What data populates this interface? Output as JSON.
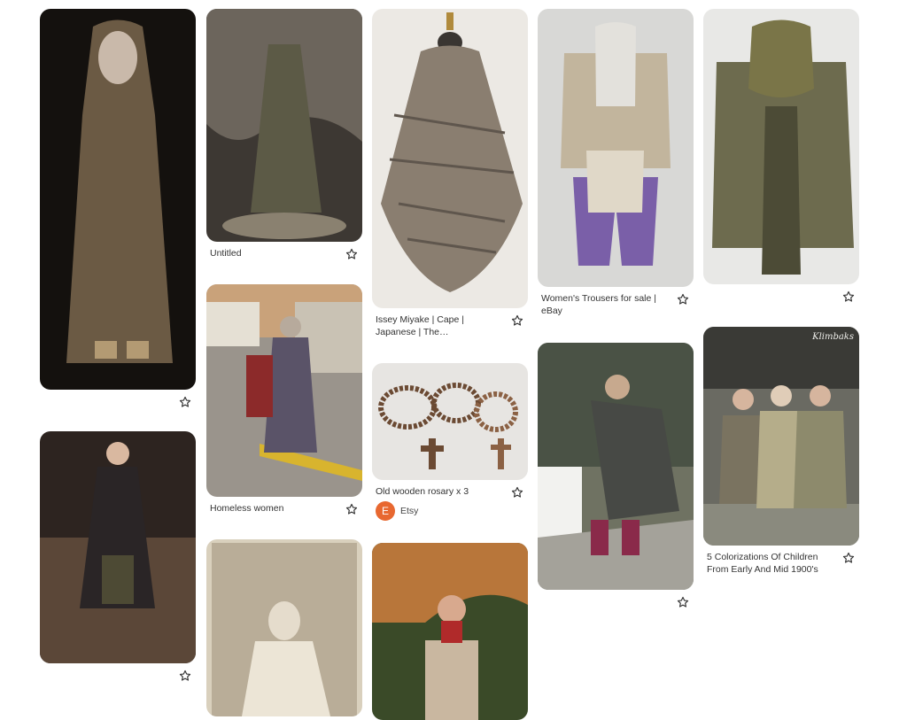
{
  "colors": {
    "text": "#333333",
    "etsy": "#e86830"
  },
  "save_icon_name": "star-outline-icon",
  "pins": [
    {
      "id": "p1",
      "title": "",
      "image_desc": "Hooded figure in layered tattered brown robes",
      "colors": [
        "#14110e",
        "#6b5a44",
        "#3a2f24"
      ]
    },
    {
      "id": "p2",
      "title": "",
      "image_desc": "Woman in dark plaid coat on runway",
      "colors": [
        "#2d2420",
        "#5a3a35",
        "#8b6b55"
      ]
    },
    {
      "id": "p3",
      "title": "Untitled",
      "image_desc": "Mannequin in ragged green costume with cloak",
      "colors": [
        "#3d3833",
        "#5c5a46",
        "#8a8170"
      ]
    },
    {
      "id": "p4",
      "title": "Homeless women",
      "image_desc": "Older woman carrying bags on street",
      "colors": [
        "#9a948c",
        "#5a5368",
        "#c9c2b4"
      ]
    },
    {
      "id": "p5",
      "title": "",
      "image_desc": "Sepia photo of child in white clothing",
      "colors": [
        "#b9ad98",
        "#8a7d69",
        "#d9d0bd"
      ]
    },
    {
      "id": "p6",
      "title": "Issey Miyake | Cape | Japanese | The Metropolitan...",
      "image_desc": "Distressed knit cape on dress form",
      "colors": [
        "#ece9e4",
        "#8a7e70",
        "#5f564d"
      ]
    },
    {
      "id": "p7",
      "title": "Old wooden rosary x 3",
      "source": {
        "initial": "E",
        "name": "Etsy"
      },
      "image_desc": "Three wooden bead rosaries with crosses",
      "colors": [
        "#e7e5e2",
        "#6b4a33",
        "#8b6144"
      ]
    },
    {
      "id": "p8",
      "title": "",
      "image_desc": "Woman in red scarf and plaid blanket",
      "colors": [
        "#3a4a28",
        "#b8763a",
        "#c9b7a0"
      ]
    },
    {
      "id": "p9",
      "title": "Women's Trousers for sale | eBay",
      "image_desc": "Layered linen top with purple trousers",
      "colors": [
        "#d8d8d6",
        "#a89c86",
        "#7a5fa8"
      ]
    },
    {
      "id": "p10",
      "title": "",
      "image_desc": "Elderly woman with shawl walking with bags",
      "colors": [
        "#6f7262",
        "#4a5245",
        "#a4a29a"
      ]
    },
    {
      "id": "p11",
      "title": "",
      "image_desc": "Olive green layered coat and scarf on mannequin",
      "colors": [
        "#e8e8e6",
        "#6d6b4e",
        "#4c4b36"
      ]
    },
    {
      "id": "p12",
      "title": "5 Colorizations Of Children From Early And Mid 1900's",
      "watermark": "Klimbaks",
      "image_desc": "Colorized photo of three children in worn clothes",
      "colors": [
        "#6a6a62",
        "#8d8a6c",
        "#b5ad8a"
      ]
    }
  ]
}
